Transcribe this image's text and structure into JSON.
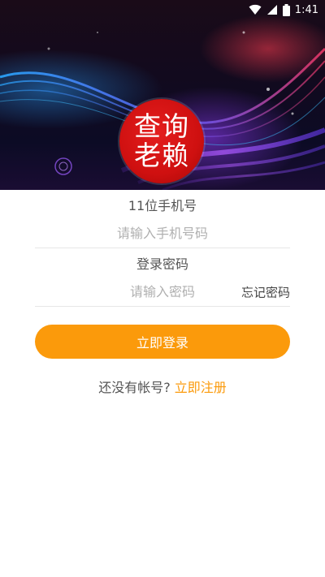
{
  "status_bar": {
    "time": "1:41",
    "icons": [
      "wifi-icon",
      "signal-icon",
      "battery-icon"
    ]
  },
  "logo": {
    "line1": "查询",
    "line2": "老赖",
    "color": "#d01414"
  },
  "login_form": {
    "phone_label": "11位手机号",
    "phone_placeholder": "请输入手机号码",
    "phone_value": "",
    "password_label": "登录密码",
    "password_placeholder": "请输入密码",
    "password_value": "",
    "forgot_label": "忘记密码",
    "login_button_label": "立即登录",
    "no_account_text": "还没有帐号?",
    "register_link_label": "立即注册"
  },
  "colors": {
    "accent": "#fb9a0b",
    "logo_red": "#d01414"
  }
}
